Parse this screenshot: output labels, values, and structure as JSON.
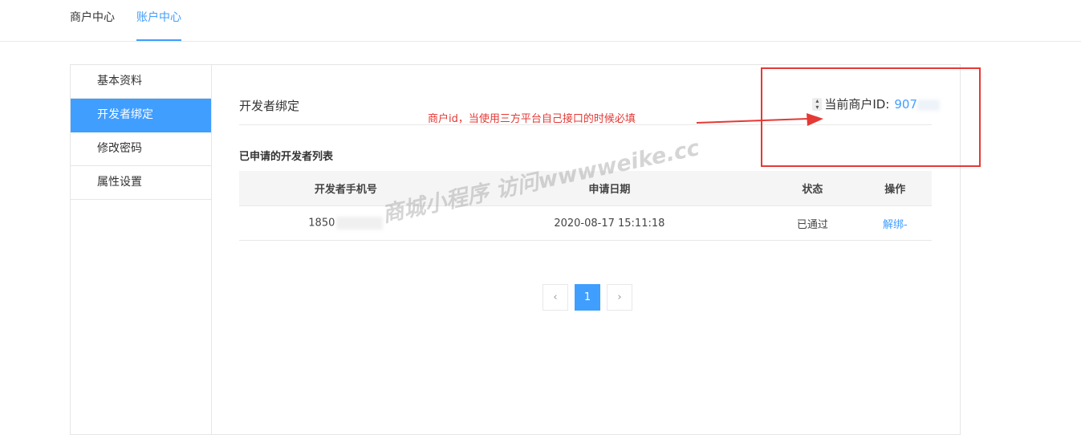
{
  "topnav": {
    "tabs": [
      {
        "label": "商户中心"
      },
      {
        "label": "账户中心"
      }
    ]
  },
  "sidebar": {
    "items": [
      {
        "label": "基本资料"
      },
      {
        "label": "开发者绑定"
      },
      {
        "label": "修改密码"
      },
      {
        "label": "属性设置"
      }
    ]
  },
  "main": {
    "section_title": "开发者绑定",
    "merchant_id_label": "当前商户ID:",
    "merchant_id_value": "907",
    "list_title": "已申请的开发者列表",
    "table": {
      "headers": [
        "开发者手机号",
        "申请日期",
        "状态",
        "操作"
      ],
      "rows": [
        {
          "phone": "1850",
          "date": "2020-08-17 15:11:18",
          "status": "已通过",
          "action": "解绑-"
        }
      ]
    },
    "pagination": {
      "prev": "‹",
      "current": "1",
      "next": "›"
    }
  },
  "annotation": {
    "text": "商户id，当使用三方平台自己接口的时候必填",
    "color": "#e53935"
  },
  "watermark": {
    "text": "商城小程序 访问wwwweike.cc"
  },
  "colors": {
    "accent": "#409eff",
    "success": "#43a047",
    "annotation_red": "#e53935"
  }
}
